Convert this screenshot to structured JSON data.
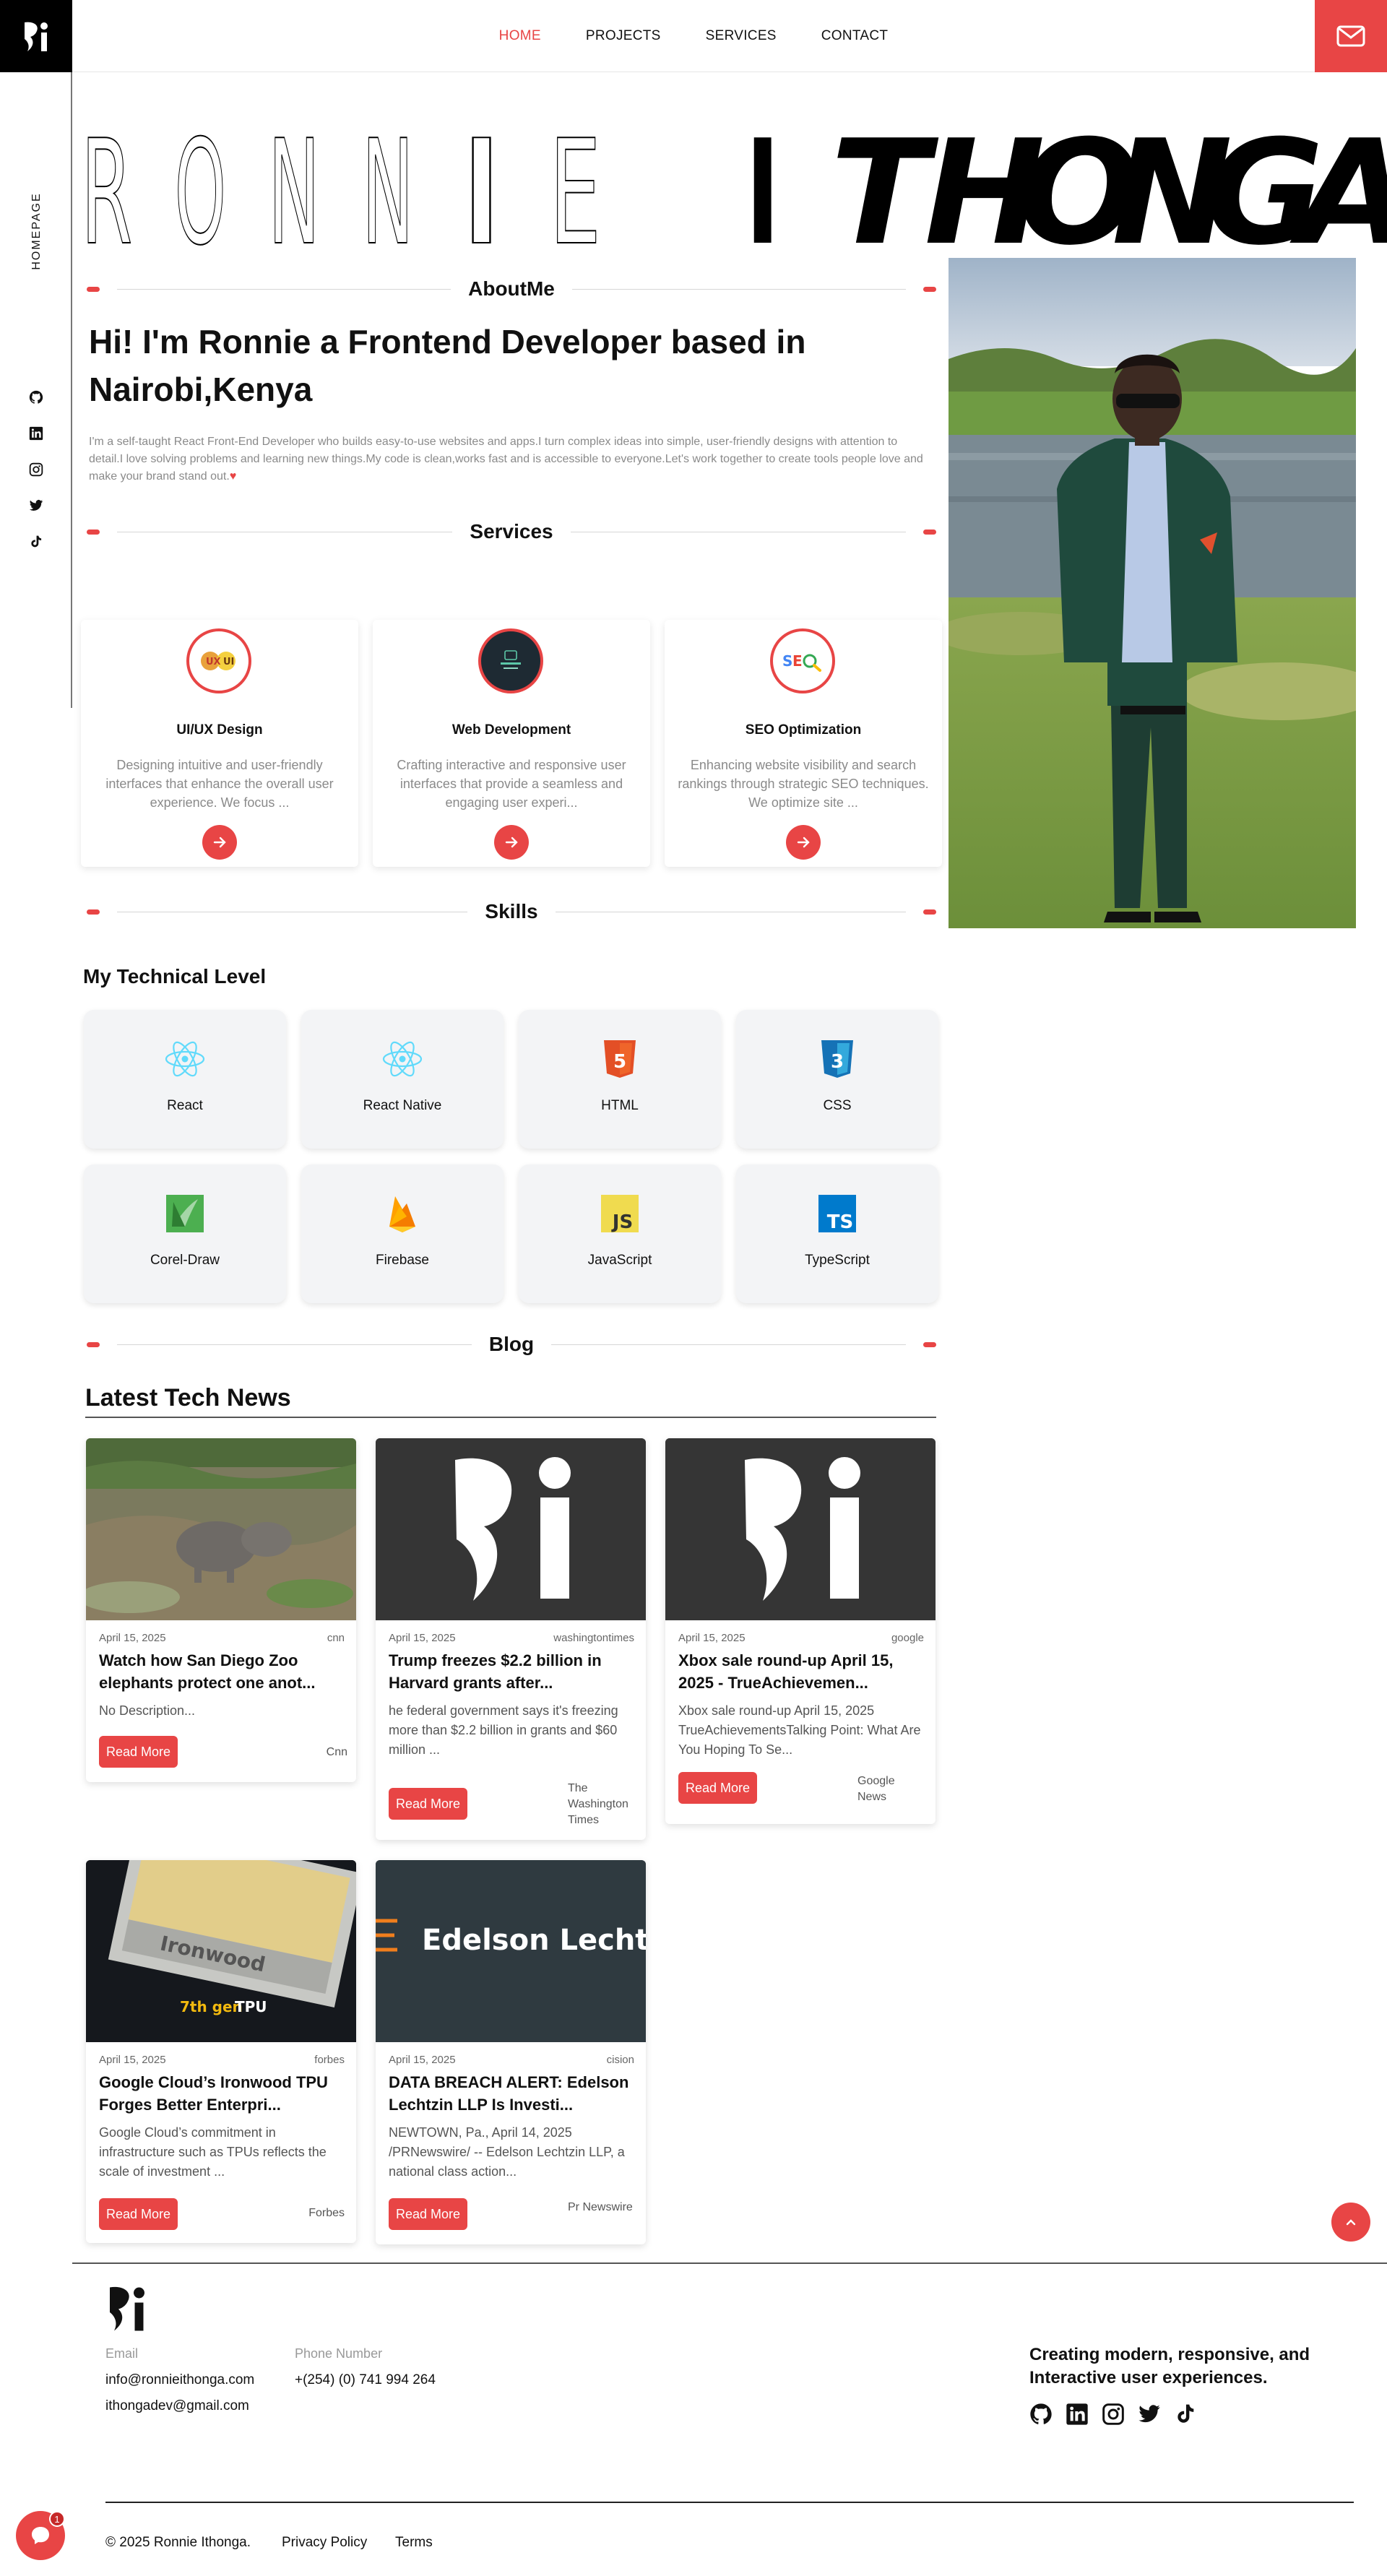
{
  "brand": {
    "logo_text": "Ri",
    "accent": "#e84545"
  },
  "nav": {
    "items": [
      "HOME",
      "PROJECTS",
      "SERVICES",
      "CONTACT"
    ],
    "active": "HOME"
  },
  "rail": {
    "label": "HOMEPAGE",
    "icons": [
      "github-icon",
      "linkedin-icon",
      "instagram-icon",
      "twitter-icon",
      "tiktok-icon"
    ]
  },
  "banner": {
    "name": "RONNIE ITHONGA"
  },
  "about": {
    "heading": "AboutMe",
    "title": "Hi! I'm Ronnie a Frontend Developer based in Nairobi,Kenya",
    "text": "I'm a self-taught React Front-End Developer who builds easy-to-use websites and apps.I turn complex ideas into simple, user-friendly designs with attention to detail.I love solving problems and learning new things.My code is clean,works fast and is accessible to everyone.Let's work together to create tools people love and make your brand stand out.",
    "heart": "♥"
  },
  "services": {
    "heading": "Services",
    "items": [
      {
        "title": "UI/UX Design",
        "desc": "Designing intuitive and user-friendly interfaces that enhance the overall user experience. We focus ..."
      },
      {
        "title": "Web Development",
        "desc": "Crafting interactive and responsive user interfaces that provide a seamless and engaging user experi..."
      },
      {
        "title": "SEO Optimization",
        "desc": "Enhancing website visibility and search rankings through strategic SEO techniques. We optimize site ..."
      }
    ]
  },
  "skills": {
    "heading": "Skills",
    "subtitle": "My Technical Level",
    "items": [
      {
        "name": "React",
        "icon": "react-icon"
      },
      {
        "name": "React Native",
        "icon": "react-icon"
      },
      {
        "name": "HTML",
        "icon": "html5-icon",
        "glyph": "5"
      },
      {
        "name": "CSS",
        "icon": "css3-icon",
        "glyph": "3"
      },
      {
        "name": "Corel-Draw",
        "icon": "coreldraw-icon"
      },
      {
        "name": "Firebase",
        "icon": "firebase-icon"
      },
      {
        "name": "JavaScript",
        "icon": "javascript-icon",
        "glyph": "JS"
      },
      {
        "name": "TypeScript",
        "icon": "typescript-icon",
        "glyph": "TS"
      }
    ]
  },
  "blog": {
    "heading": "Blog",
    "title": "Latest Tech News",
    "read_more": "Read More",
    "posts": [
      {
        "date": "April 15, 2025",
        "source": "cnn",
        "title": "Watch how San Diego Zoo elephants protect one anot...",
        "body": "No Description...",
        "publisher": "Cnn"
      },
      {
        "date": "April 15, 2025",
        "source": "washingtontimes",
        "title": "Trump freezes $2.2 billion in Harvard grants after...",
        "body": "he federal government says it's freezing more than $2.2 billion in grants and $60 million ...",
        "publisher": "The Washington Times"
      },
      {
        "date": "April 15, 2025",
        "source": "google",
        "title": "Xbox sale round-up April 15, 2025 - TrueAchievemen...",
        "body": "Xbox sale round-up April 15, 2025 TrueAchievementsTalking Point: What Are You Hoping To Se...",
        "publisher": "Google News"
      },
      {
        "date": "April 15, 2025",
        "source": "forbes",
        "title": "Google Cloud’s Ironwood TPU Forges Better Enterpri...",
        "body": "Google Cloud’s commitment in infrastructure such as TPUs reflects the scale of investment ...",
        "publisher": "Forbes",
        "img_text": "Ironwood",
        "img_sub_accent": "7th gen",
        "img_sub": "TPU"
      },
      {
        "date": "April 15, 2025",
        "source": "cision",
        "title": "DATA BREACH ALERT: Edelson Lechtzin LLP Is Investi...",
        "body": "NEWTOWN, Pa., April 14, 2025 /PRNewswire/ -- Edelson Lechtzin LLP, a national class action...",
        "publisher": "Pr Newswire",
        "img_text": "Edelson Lechtz"
      }
    ]
  },
  "footer": {
    "email_label": "Email",
    "emails": [
      "info@ronnieithonga.com",
      "ithongadev@gmail.com"
    ],
    "phone_label": "Phone Number",
    "phone": "+(254) (0) 741 994 264",
    "tagline": "Creating modern, responsive, and Interactive user experiences.",
    "copyright": "© 2025 Ronnie Ithonga.",
    "links": [
      "Privacy Policy",
      "Terms"
    ]
  },
  "chat": {
    "badge": "1"
  }
}
